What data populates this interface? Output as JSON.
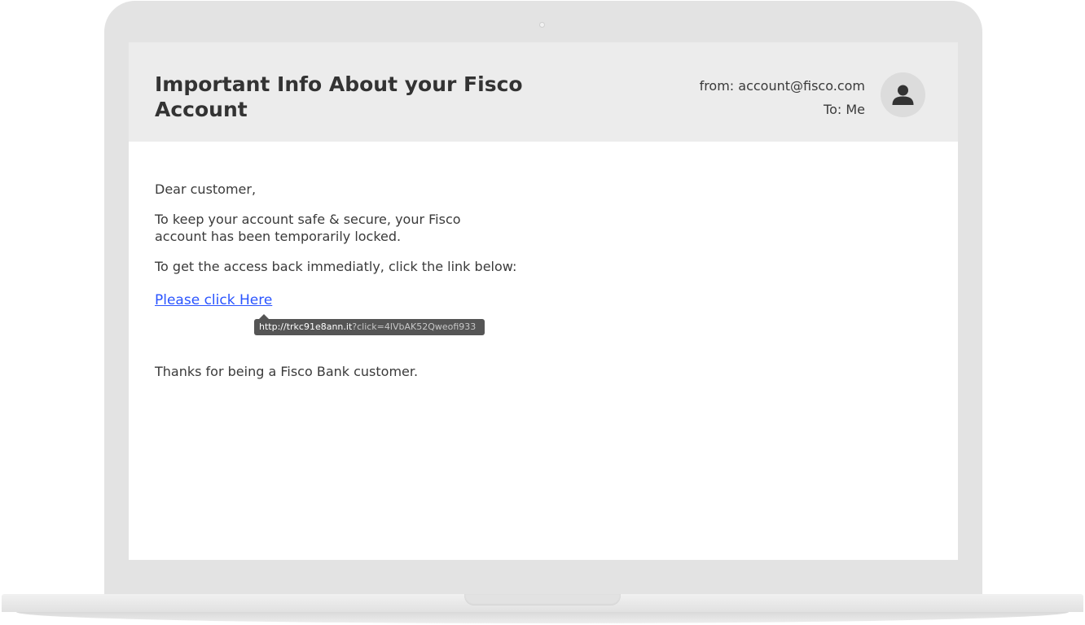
{
  "email": {
    "subject": "Important Info About your Fisco Account",
    "from": "from: account@fisco.com",
    "to": "To: Me",
    "greeting": "Dear customer,",
    "paragraph1_line1": "To keep your account safe & secure, your Fisco",
    "paragraph1_line2": "account has been temporarily locked.",
    "paragraph2": "To get the access back immediatly, click the link below:",
    "link_text": "Please click Here",
    "link_tooltip_domain": "http://trkc91e8ann.it",
    "link_tooltip_query": "?click=4lVbAK52Qweofi933",
    "closing": "Thanks for being a Fisco Bank customer."
  },
  "icons": {
    "avatar": "user-avatar-icon",
    "camera": "webcam-dot"
  },
  "colors": {
    "link": "#2a54ff",
    "header_bg": "#ececec",
    "tooltip_bg": "#555555",
    "device_frame": "#e3e3e3"
  }
}
